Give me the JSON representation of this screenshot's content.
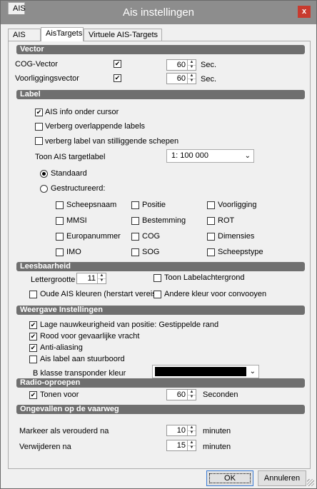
{
  "window": {
    "title": "Ais instellingen",
    "close_glyph": "x"
  },
  "tabs": [
    "AIS",
    "AisTargets",
    "Virtuele AIS-Targets"
  ],
  "sections": {
    "vector": "Vector",
    "label": "Label",
    "leesbaarheid": "Leesbaarheid",
    "weergave": "Weergave Instellingen",
    "radio": "Radio-oproepen",
    "ongevallen": "Ongevallen op de vaarweg"
  },
  "vector": {
    "cog_label": "COG-Vector",
    "cog_checked": true,
    "cog_value": "60",
    "cog_unit": "Sec.",
    "voor_label": "Voorliggingsvector",
    "voor_checked": true,
    "voor_value": "60",
    "voor_unit": "Sec."
  },
  "label": {
    "ais_info": "AIS info onder cursor",
    "ais_info_checked": true,
    "verberg_overlap": "Verberg overlappende labels",
    "verberg_overlap_checked": false,
    "verberg_stil": "verberg label van stilliggende schepen",
    "verberg_stil_checked": false,
    "toon_label": "Toon AIS targetlabel",
    "scale_value": "1:  100 000",
    "standaard": "Standaard",
    "gestructureerd": "Gestructureerd:",
    "fields": [
      [
        "Scheepsnaam",
        "Positie",
        "Voorligging"
      ],
      [
        "MMSI",
        "Bestemming",
        "ROT"
      ],
      [
        "Europanummer",
        "COG",
        "Dimensies"
      ],
      [
        "IMO",
        "SOG",
        "Scheepstype"
      ]
    ]
  },
  "lees": {
    "lettergrootte": "Lettergrootte",
    "lettergrootte_value": "11",
    "toon_achtergrond": "Toon Labelachtergrond",
    "oude_kleuren": "Oude AIS kleuren (herstart vereist)",
    "andere_kleur": "Andere kleur voor convooyen"
  },
  "weergave": {
    "items": [
      {
        "label": "Lage nauwkeurigheid van positie: Gestippelde rand",
        "checked": true
      },
      {
        "label": "Rood voor gevaarlijke vracht",
        "checked": true
      },
      {
        "label": "Anti-aliasing",
        "checked": true
      },
      {
        "label": "Ais label aan stuurboord",
        "checked": false
      }
    ],
    "b_klasse": "B klasse transponder kleur",
    "b_klasse_color": "#000000"
  },
  "radio": {
    "tonen": "Tonen voor",
    "tonen_checked": true,
    "value": "60",
    "unit": "Seconden"
  },
  "ongevallen": {
    "markeer": "Markeer als verouderd na",
    "markeer_value": "10",
    "markeer_unit": "minuten",
    "verwijderen": "Verwijderen na",
    "verwijderen_value": "15",
    "verwijderen_unit": "minuten"
  },
  "buttons": {
    "ok": "OK",
    "cancel": "Annuleren"
  }
}
